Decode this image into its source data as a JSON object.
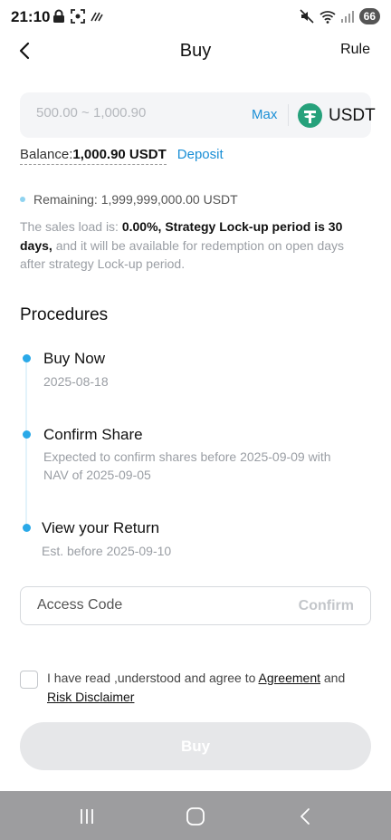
{
  "status": {
    "time": "21:10",
    "battery": "66"
  },
  "header": {
    "title": "Buy",
    "rule_label": "Rule"
  },
  "amount": {
    "placeholder": "500.00 ~ 1,000.90",
    "max_label": "Max",
    "currency": "USDT",
    "currency_icon": "tether-icon",
    "accent": "#1a8fd6",
    "tether_color": "#26a17b"
  },
  "balance": {
    "label": "Balance:",
    "value": "1,000.90 USDT",
    "deposit_label": "Deposit"
  },
  "remaining": {
    "text": "Remaining: 1,999,999,000.00 USDT"
  },
  "sales_note": {
    "prefix": "The sales load is: ",
    "bold": "0.00%, Strategy Lock-up period is 30 days,",
    "suffix": " and it will be available for redemption on open days after strategy Lock-up period."
  },
  "procedures": {
    "title": "Procedures",
    "steps": [
      {
        "title": "Buy Now",
        "sub": "2025-08-18"
      },
      {
        "title": "Confirm Share",
        "sub": "Expected to confirm shares before 2025-09-09 with NAV of 2025-09-05"
      },
      {
        "title": "View your Return",
        "sub": "Est. before 2025-09-10"
      }
    ],
    "dot_color": "#2aa9e8"
  },
  "access_code": {
    "placeholder": "Access Code",
    "confirm_label": "Confirm"
  },
  "agreement": {
    "text_1": "I have read ,understood and agree to ",
    "agreement_link": "Agreement",
    "text_2": " and ",
    "risk_link": "Risk Disclaimer"
  },
  "buy_button": {
    "label": "Buy"
  }
}
